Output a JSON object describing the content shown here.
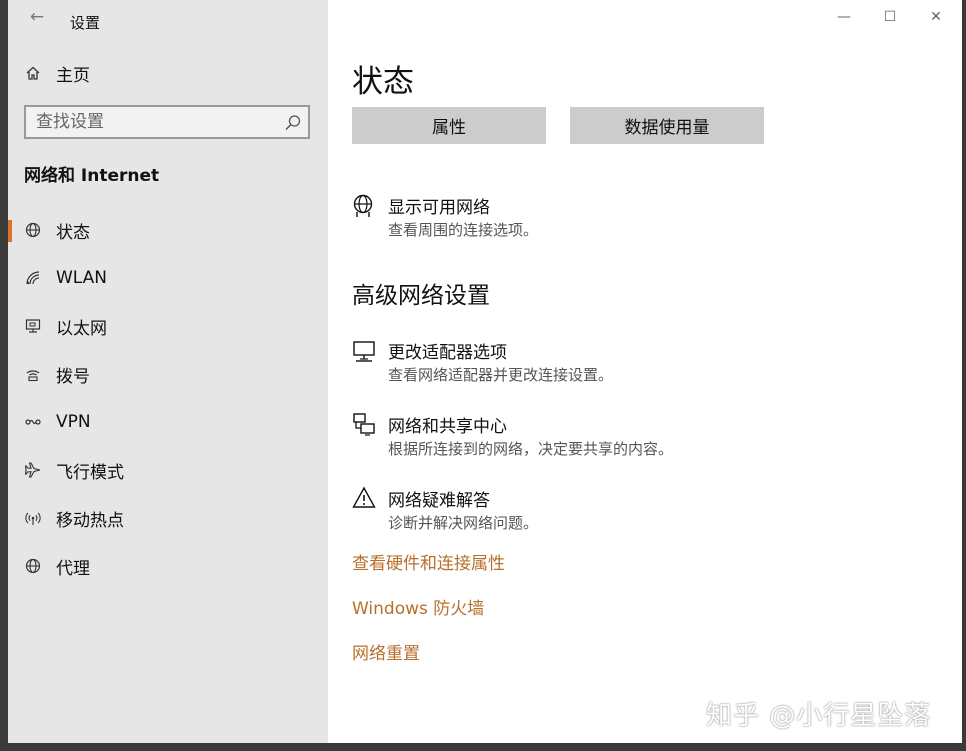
{
  "window": {
    "app_title": "设置",
    "controls": {
      "minimize": "—",
      "maximize": "☐",
      "close": "✕"
    }
  },
  "sidebar": {
    "home_label": "主页",
    "search_placeholder": "查找设置",
    "section_title": "网络和 Internet",
    "items": [
      {
        "label": "状态",
        "icon": "globe-icon",
        "active": true
      },
      {
        "label": "WLAN",
        "icon": "wifi-icon"
      },
      {
        "label": "以太网",
        "icon": "ethernet-icon"
      },
      {
        "label": "拨号",
        "icon": "dialup-icon"
      },
      {
        "label": "VPN",
        "icon": "vpn-icon"
      },
      {
        "label": "飞行模式",
        "icon": "airplane-icon"
      },
      {
        "label": "移动热点",
        "icon": "hotspot-icon"
      },
      {
        "label": "代理",
        "icon": "globe-icon"
      }
    ]
  },
  "main": {
    "title": "状态",
    "tabs": [
      {
        "label": "属性"
      },
      {
        "label": "数据使用量"
      }
    ],
    "show_networks": {
      "title": "显示可用网络",
      "desc": "查看周围的连接选项。",
      "icon": "network-globe-icon"
    },
    "advanced_heading": "高级网络设置",
    "advanced_items": [
      {
        "title": "更改适配器选项",
        "desc": "查看网络适配器并更改连接设置。",
        "icon": "monitor-icon"
      },
      {
        "title": "网络和共享中心",
        "desc": "根据所连接到的网络，决定要共享的内容。",
        "icon": "sharing-center-icon"
      },
      {
        "title": "网络疑难解答",
        "desc": "诊断并解决网络问题。",
        "icon": "warning-icon"
      }
    ],
    "links": [
      {
        "label": "查看硬件和连接属性"
      },
      {
        "label": "Windows 防火墙"
      },
      {
        "label": "网络重置"
      }
    ],
    "link_color": "#b7702c"
  },
  "watermark": "知乎 @小行星坠落",
  "colors": {
    "accent": "#d9742a",
    "sidebar_bg": "#e6e6e6",
    "tab_bg": "#cccccc"
  }
}
